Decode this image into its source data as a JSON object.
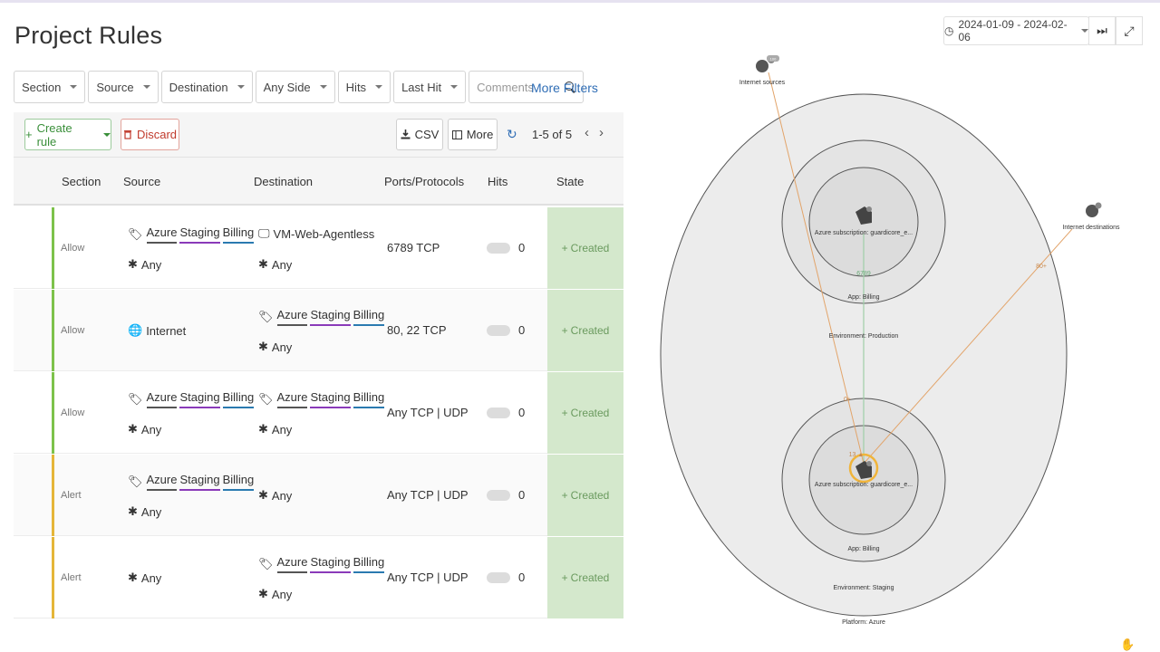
{
  "page": {
    "title": "Project Rules"
  },
  "filters": {
    "items": [
      {
        "label": "Section"
      },
      {
        "label": "Source"
      },
      {
        "label": "Destination"
      },
      {
        "label": "Any Side"
      },
      {
        "label": "Hits"
      },
      {
        "label": "Last Hit"
      }
    ],
    "comments_placeholder": "Comments",
    "more_filters": "More Filters"
  },
  "toolbar": {
    "create_rule": "Create rule",
    "discard": "Discard",
    "csv": "CSV",
    "more": "More",
    "pager": "1-5 of 5"
  },
  "table": {
    "headers": {
      "section": "Section",
      "source": "Source",
      "destination": "Destination",
      "ports": "Ports/Protocols",
      "hits": "Hits",
      "state": "State"
    },
    "rows": [
      {
        "section": "Allow",
        "ports": "6789 TCP",
        "hits": "0",
        "state": "Created"
      },
      {
        "section": "Allow",
        "ports": "80, 22 TCP",
        "hits": "0",
        "state": "Created"
      },
      {
        "section": "Allow",
        "ports": "Any TCP | UDP",
        "hits": "0",
        "state": "Created"
      },
      {
        "section": "Alert",
        "ports": "Any TCP | UDP",
        "hits": "0",
        "state": "Created"
      },
      {
        "section": "Alert",
        "ports": "Any TCP | UDP",
        "hits": "0",
        "state": "Created"
      }
    ],
    "labels": {
      "azure": "Azure",
      "staging": "Staging",
      "billing": "Billing",
      "any": "Any",
      "internet": "Internet",
      "vm": "VM-Web-Agentless"
    },
    "colors": {
      "allow": "#7dc24b",
      "alert": "#e5b638",
      "state_bg": "#d4e8cc"
    }
  },
  "map": {
    "date_range": "2024-01-09 - 2024-02-06",
    "internet_sources": "Internet sources",
    "internet_destinations": "Internet destinations",
    "node_top": "Azure subscription: guardicore_e...",
    "node_bottom": "Azure subscription: guardicore_e...",
    "app_billing_top": "App: Billing",
    "env_production": "Environment: Production",
    "app_billing_bottom": "App: Billing",
    "env_staging": "Environment: Staging",
    "platform": "Platform: Azure",
    "edge_6789": "6789",
    "edge_80": "80+",
    "edge_0": "0+",
    "edge_13": "13 ▲",
    "badge": "100"
  }
}
